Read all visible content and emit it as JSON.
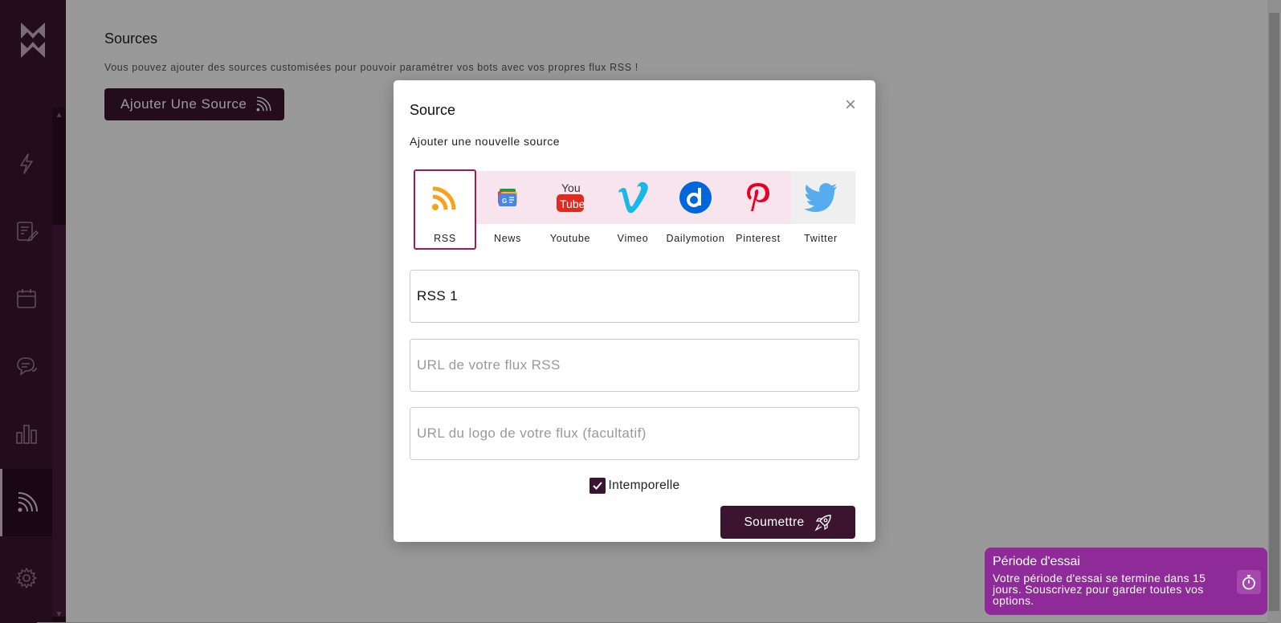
{
  "sidebar": {
    "items": [
      {
        "name": "lightning-icon"
      },
      {
        "name": "edit-document-icon"
      },
      {
        "name": "calendar-icon"
      },
      {
        "name": "chat-icon"
      },
      {
        "name": "bar-chart-icon"
      },
      {
        "name": "rss-icon",
        "active": true
      },
      {
        "name": "gear-icon"
      }
    ]
  },
  "main": {
    "title": "Sources",
    "description": "Vous pouvez ajouter des sources customisées pour pouvoir paramétrer vos bots avec vos propres flux RSS !",
    "add_button_label": "Ajouter Une Source"
  },
  "modal": {
    "title": "Source",
    "close_symbol": "×",
    "subtitle": "Ajouter une nouvelle source",
    "sources": [
      {
        "label": "RSS",
        "icon": "rss-icon",
        "selected": true
      },
      {
        "label": "News",
        "icon": "google-news-icon"
      },
      {
        "label": "Youtube",
        "icon": "youtube-icon"
      },
      {
        "label": "Vimeo",
        "icon": "vimeo-icon"
      },
      {
        "label": "Dailymotion",
        "icon": "dailymotion-icon"
      },
      {
        "label": "Pinterest",
        "icon": "pinterest-icon"
      },
      {
        "label": "Twitter",
        "icon": "twitter-icon"
      }
    ],
    "name_value": "RSS 1",
    "url_placeholder": "URL de votre flux RSS",
    "logo_placeholder": "URL du logo de votre flux (facultatif)",
    "checkbox_label": "Intemporelle",
    "checkbox_checked": true,
    "submit_label": "Soumettre"
  },
  "trial": {
    "title": "Période d'essai",
    "text": "Votre période d'essai se termine dans 15 jours. Souscrivez pour garder toutes vos options."
  },
  "colors": {
    "brand": "#3b1530",
    "accent": "#9c1a5e",
    "trial": "#8f2b98",
    "rss_orange": "#f7a21b"
  }
}
